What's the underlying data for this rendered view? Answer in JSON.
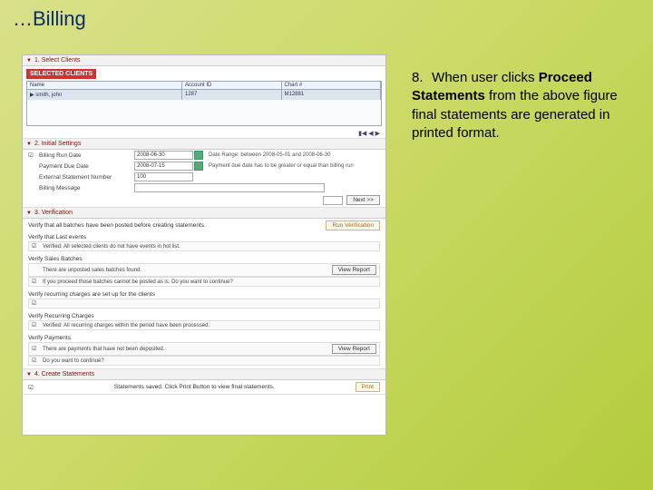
{
  "page": {
    "title": "…Billing"
  },
  "instruction": {
    "number": "8.",
    "prefix": "When user clicks",
    "bold": "Proceed Statements",
    "rest": "from the above figure final statements are generated in printed format."
  },
  "sections": {
    "select_clients": {
      "header": "1. Select Clients",
      "badge": "SELECTED CLIENTS",
      "columns": [
        "Name",
        "Account ID",
        "Chart #"
      ],
      "row": [
        "smith, john",
        "1287",
        "M12881"
      ]
    },
    "initial_settings": {
      "header": "2. Initial Settings",
      "rows": {
        "billing_run": {
          "label": "Billing Run Date",
          "value": "2008-06-30",
          "hint": "Date Range: between 2008-05-01 and 2008-06-30"
        },
        "payment_due": {
          "label": "Payment Due Date",
          "value": "2008-07-15",
          "hint": "Payment due date has to be greater or equal than billing run"
        },
        "ext_stmt": {
          "label": "External Statement Number",
          "value": "100"
        },
        "billing_msg": {
          "label": "Billing Message",
          "value": ""
        }
      },
      "next_btn": "Next >>"
    },
    "verification": {
      "header": "3. Verification",
      "top_msg": "Verify that all batches have been posted before creating statements.",
      "top_btn": "Run Verification",
      "groups": {
        "last_events": {
          "title": "Verify that Last events",
          "msg": "Verified: All selected clients do not have events in hot list."
        },
        "sales_batches": {
          "title": "Verify Sales Batches",
          "msg1": "There are unposted sales batches found.",
          "msg2": "If you proceed those batches cannot be posted as is. Do you want to continue?",
          "btn": "View Report"
        },
        "recurring_setup": {
          "title": "Verify recurring charges are set up for the clients",
          "msg": ""
        },
        "recurring_charges": {
          "title": "Verify Recurring Charges",
          "msg": "Verified: All recurring charges within the period have been processed."
        },
        "payments": {
          "title": "Verify Payments",
          "msg1": "There are payments that have not been deposited.",
          "msg2": "Do you want to continue?",
          "btn": "View Report"
        }
      }
    },
    "create_statements": {
      "header": "4. Create Statements",
      "msg": "Statements saved. Click Print Button to view final statements.",
      "btn": "Print"
    }
  }
}
